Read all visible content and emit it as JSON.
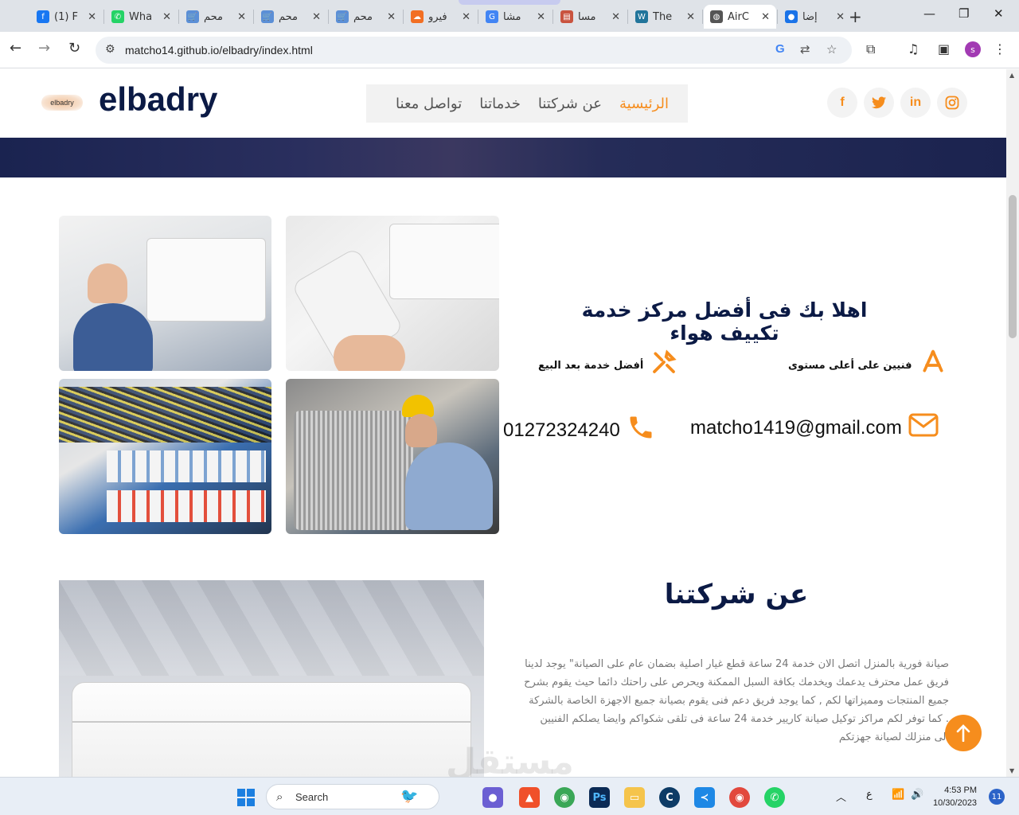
{
  "browser": {
    "tabs": [
      {
        "title": "(1) F",
        "favicon": "facebook-icon",
        "color": "#1877f2",
        "glyph": "f"
      },
      {
        "title": "Wha",
        "favicon": "whatsapp-icon",
        "color": "#25d366",
        "glyph": "✆"
      },
      {
        "title": "محم",
        "favicon": "cart-icon",
        "color": "#5b8fd6",
        "glyph": "🛒"
      },
      {
        "title": "محم",
        "favicon": "cart-icon",
        "color": "#5b8fd6",
        "glyph": "🛒"
      },
      {
        "title": "محم",
        "favicon": "cart-icon",
        "color": "#5b8fd6",
        "glyph": "🛒"
      },
      {
        "title": "فيرو",
        "favicon": "soundcloud-icon",
        "color": "#f26f23",
        "glyph": "☁"
      },
      {
        "title": "مشا",
        "favicon": "google-icon",
        "color": "#4285f4",
        "glyph": "G"
      },
      {
        "title": "مسا",
        "favicon": "page-icon",
        "color": "#c9533f",
        "glyph": "▤"
      },
      {
        "title": "The",
        "favicon": "wordpress-icon",
        "color": "#21759b",
        "glyph": "W"
      },
      {
        "title": "AirC",
        "favicon": "globe-icon",
        "color": "#555555",
        "glyph": "◍",
        "active": true
      },
      {
        "title": "إضا",
        "favicon": "circle-icon",
        "color": "#1a73e8",
        "glyph": "●"
      }
    ],
    "url": "matcho14.github.io/elbadry/index.html",
    "profile_initial": "s"
  },
  "site": {
    "logo_badge": "elbadry",
    "brand": "elbadry",
    "nav": [
      "الرئيسية",
      "عن شركتنا",
      "خدماتنا",
      "تواصل معنا"
    ],
    "social": [
      {
        "name": "facebook-icon",
        "glyph": "f"
      },
      {
        "name": "twitter-icon",
        "glyph": "🐦"
      },
      {
        "name": "linkedin-icon",
        "glyph": "in"
      },
      {
        "name": "instagram-icon",
        "glyph": "◎"
      }
    ],
    "accent": "#f68d1d",
    "dark_blue": "#0b1a45"
  },
  "welcome": {
    "title": "اهلا بك فى أفضل مركز خدمة تكييف هواء",
    "feature_1": "فنيين على أعلى مستوى",
    "feature_2": "أفضل خدمة بعد البيع",
    "email": "matcho1419@gmail.com",
    "phone": "01272324240"
  },
  "about": {
    "title": "عن شركتنا",
    "text": "صيانة فورية بالمنزل اتصل الان خدمة 24 ساعة قطع غيار اصلية بضمان عام على الصيانة\" يوجد لدينا فريق عمل محترف يدعمك ويخدمك بكافة السبل الممكنة ويحرص على راحتك دائما حيث يقوم بشرح جميع المنتجات ومميزاتها لكم , كما يوجد فريق دعم فنى يقوم بصيانة جميع الاجهزة الخاصة بالشركة . كما توفر لكم مراكز توكيل صيانة كاريير خدمة 24 ساعة فى تلقى شكواكم وايضا يصلكم الفنيين الى منزلك لصيانة جهزتكم"
  },
  "watermark": "مستقل",
  "taskbar": {
    "search_placeholder": "Search",
    "time": "4:53 PM",
    "date": "10/30/2023",
    "lang": "ع",
    "notifications": "11"
  }
}
